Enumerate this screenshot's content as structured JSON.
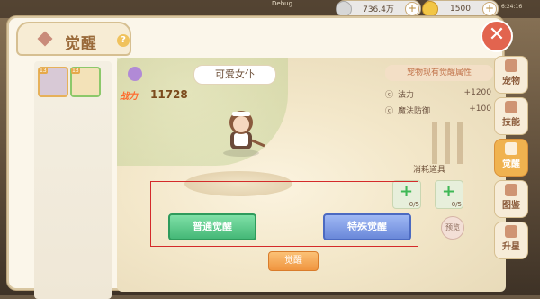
{
  "hud": {
    "debug_label": "Debug",
    "silver_value": "736.4万",
    "gold_value": "1500",
    "clock": "6:24:16"
  },
  "panel": {
    "title": "觉醒",
    "help_label": "?"
  },
  "pet_list": [
    {
      "level": "13"
    },
    {
      "level": "13"
    }
  ],
  "pet": {
    "name": "可爱女仆",
    "power_label": "战力",
    "power_value": "11728"
  },
  "attributes": {
    "header": "宠物现有觉醒属性",
    "items": [
      {
        "icon": "ⓒ",
        "name": "法力",
        "value": "+1200"
      },
      {
        "icon": "ⓒ",
        "name": "魔法防御",
        "value": "+100"
      }
    ]
  },
  "consume": {
    "header": "消耗道具",
    "items": [
      {
        "count": "0/5"
      },
      {
        "count": "0/5"
      }
    ]
  },
  "buttons": {
    "normal": "普通觉醒",
    "special": "特殊觉醒",
    "preview": "预览",
    "awaken": "觉醒"
  },
  "side_tabs": [
    {
      "label": "宠物",
      "icon": "paw-icon",
      "active": false
    },
    {
      "label": "技能",
      "icon": "skill-icon",
      "active": false
    },
    {
      "label": "觉醒",
      "icon": "awaken-icon",
      "active": true
    },
    {
      "label": "图鉴",
      "icon": "book-icon",
      "active": false
    },
    {
      "label": "升星",
      "icon": "star-icon",
      "active": false
    }
  ],
  "colors": {
    "accent": "#f0b24f",
    "normal_button": "#45b877",
    "special_button": "#6a88d9",
    "highlight_box": "#d42a2a",
    "power": "#ff6a2c"
  }
}
